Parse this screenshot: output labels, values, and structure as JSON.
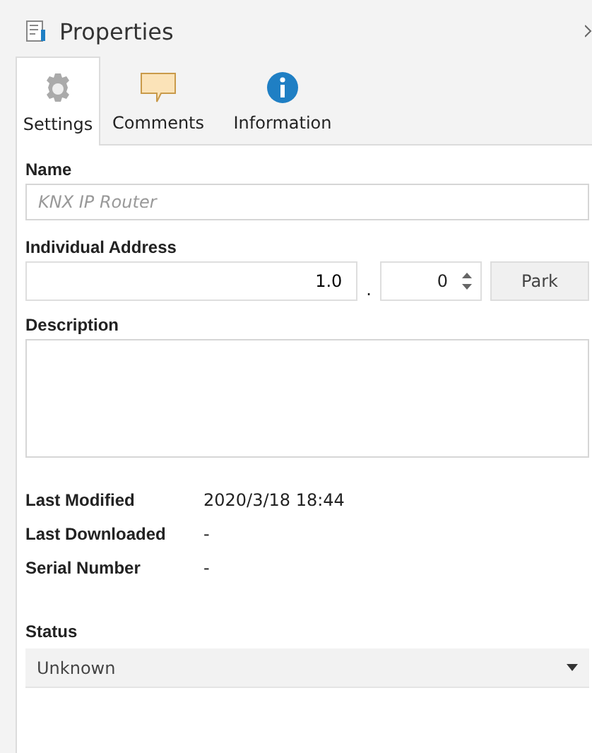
{
  "window": {
    "title": "Properties"
  },
  "tabs": [
    {
      "label": "Settings",
      "selected": true
    },
    {
      "label": "Comments",
      "selected": false
    },
    {
      "label": "Information",
      "selected": false
    }
  ],
  "name": {
    "label": "Name",
    "placeholder": "KNX IP Router"
  },
  "address": {
    "label": "Individual Address",
    "value": "1.0",
    "separator": ".",
    "device": "0",
    "button": "Park"
  },
  "description": {
    "label": "Description"
  },
  "details": [
    {
      "label": "Last Modified",
      "value": "2020/3/18 18:44"
    },
    {
      "label": "Last Downloaded",
      "value": "-"
    },
    {
      "label": "Serial Number",
      "value": "-"
    }
  ],
  "status": {
    "label": "Status",
    "value": "Unknown"
  }
}
